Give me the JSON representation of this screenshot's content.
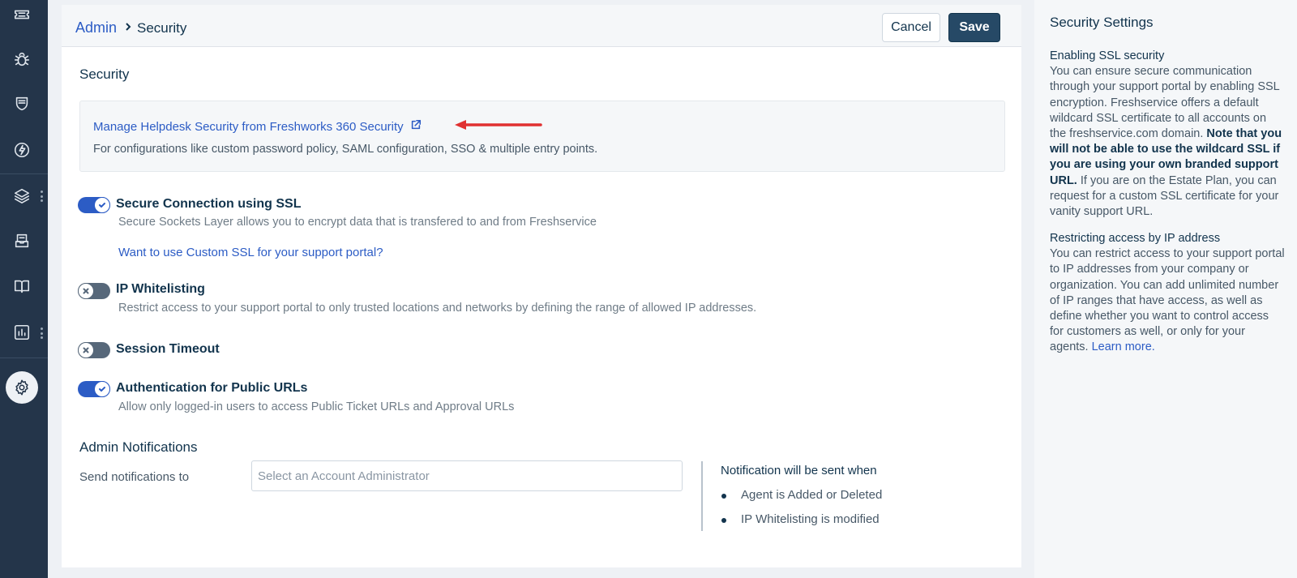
{
  "rail": {
    "icons": [
      "ticket-icon",
      "bug-icon",
      "shield-icon",
      "lightning-icon",
      "layers-icon",
      "inbox-icon",
      "book-icon",
      "chart-icon",
      "gear-icon"
    ]
  },
  "breadcrumb": {
    "parent": "Admin",
    "current": "Security"
  },
  "header": {
    "cancel_label": "Cancel",
    "save_label": "Save"
  },
  "security": {
    "section_title": "Security",
    "info_link": "Manage Helpdesk Security from Freshworks 360 Security",
    "info_desc": "For configurations like custom password policy, SAML configuration, SSO & multiple entry points."
  },
  "settings": [
    {
      "title": "Secure Connection using SSL",
      "enabled": true,
      "description": "Secure Sockets Layer allows you to encrypt data that is transfered to and from Freshservice",
      "link": "Want to use Custom SSL for your support portal?"
    },
    {
      "title": "IP Whitelisting",
      "enabled": false,
      "description": "Restrict access to your support portal to only trusted locations and networks by defining the range of allowed IP addresses."
    },
    {
      "title": "Session Timeout",
      "enabled": false
    },
    {
      "title": "Authentication for Public URLs",
      "enabled": true,
      "description": "Allow only logged-in users to access Public Ticket URLs and Approval URLs"
    }
  ],
  "notifications": {
    "title": "Admin Notifications",
    "send_label": "Send notifications to",
    "input_placeholder": "Select an Account Administrator",
    "when_title": "Notification will be sent when",
    "items": [
      "Agent is Added or Deleted",
      "IP Whitelisting is modified"
    ]
  },
  "help": {
    "title": "Security Settings",
    "ssl_heading": "Enabling SSL security",
    "ssl_text_1": "You can ensure secure communication through your support portal by enabling SSL encryption. Freshservice offers a default wildcard SSL certificate to all accounts on the freshservice.com domain.",
    "ssl_note": "Note that you will not be able to use the wildcard SSL if you are using your own branded support URL.",
    "ssl_text_2": "If you are on the Estate Plan, you can request for a custom SSL certificate for your vanity support URL.",
    "ip_heading": "Restricting access by IP address",
    "ip_text": "You can restrict access to your support portal to IP addresses from your company or organization. You can add unlimited number of IP ranges that have access, as well as define whether you want to control access for customers as well, or only for your agents.",
    "learn_more": "Learn more."
  },
  "colors": {
    "rail_bg": "#24354a",
    "accent": "#2c5cc5",
    "save_bg": "#264966",
    "annotation_arrow": "#e03131"
  }
}
